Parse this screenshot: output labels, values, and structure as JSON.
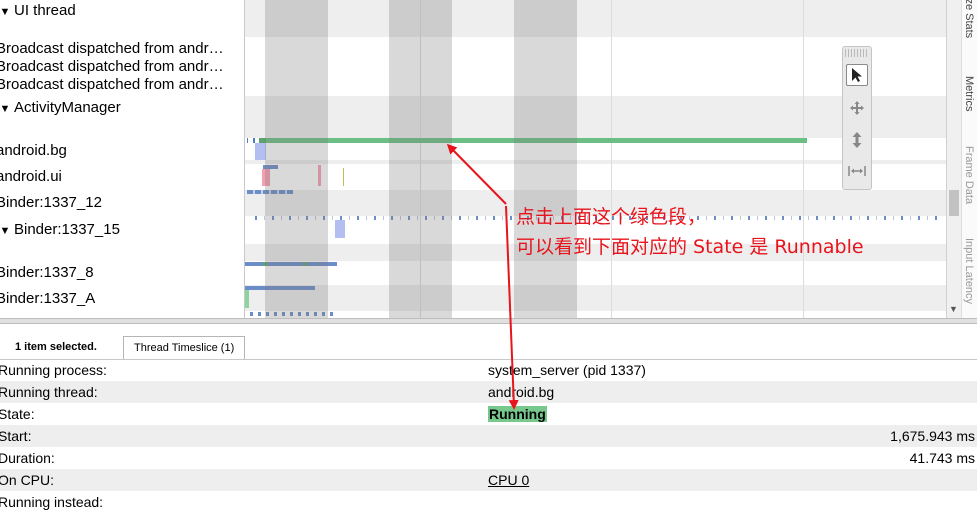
{
  "threads": [
    {
      "label": "UI thread",
      "expanded": true
    },
    {
      "label": "Broadcast dispatched from andr…"
    },
    {
      "label": "Broadcast dispatched from andr…"
    },
    {
      "label": "Broadcast dispatched from andr…"
    },
    {
      "label": "ActivityManager",
      "expanded": true
    },
    {
      "label": "android.bg"
    },
    {
      "label": "android.ui"
    },
    {
      "label": "Binder:1337_12"
    },
    {
      "label": "Binder:1337_15",
      "expanded": true
    },
    {
      "label": "Binder:1337_8"
    },
    {
      "label": "Binder:1337_A"
    }
  ],
  "side_tabs": [
    "ize Stats",
    "Metrics",
    "Frame Data",
    "Input Latency"
  ],
  "tools": [
    "select-tool",
    "pan-tool",
    "zoom-tool",
    "timing-tool"
  ],
  "panel": {
    "selection_count": "1 item selected.",
    "tab_label": "Thread Timeslice (1)",
    "rows": [
      {
        "key": "Running process:",
        "value": "system_server (pid 1337)"
      },
      {
        "key": "Running thread:",
        "value": "android.bg"
      },
      {
        "key": "State:",
        "value": "Running"
      },
      {
        "key": "Start:",
        "value": "1,675.943 ms"
      },
      {
        "key": "Duration:",
        "value": "41.743 ms"
      },
      {
        "key": "On CPU:",
        "value": "CPU 0"
      },
      {
        "key": "Running instead:",
        "value": ""
      }
    ]
  },
  "annotation": {
    "line1": "点击上面这个绿色段，",
    "line2": "可以看到下面对应的 State 是 Runnable"
  },
  "colors": {
    "running": "#77c88c",
    "runnable": "#6c8ec8",
    "sleeping": "#f4a0b0",
    "annotation": "#e8141c"
  }
}
